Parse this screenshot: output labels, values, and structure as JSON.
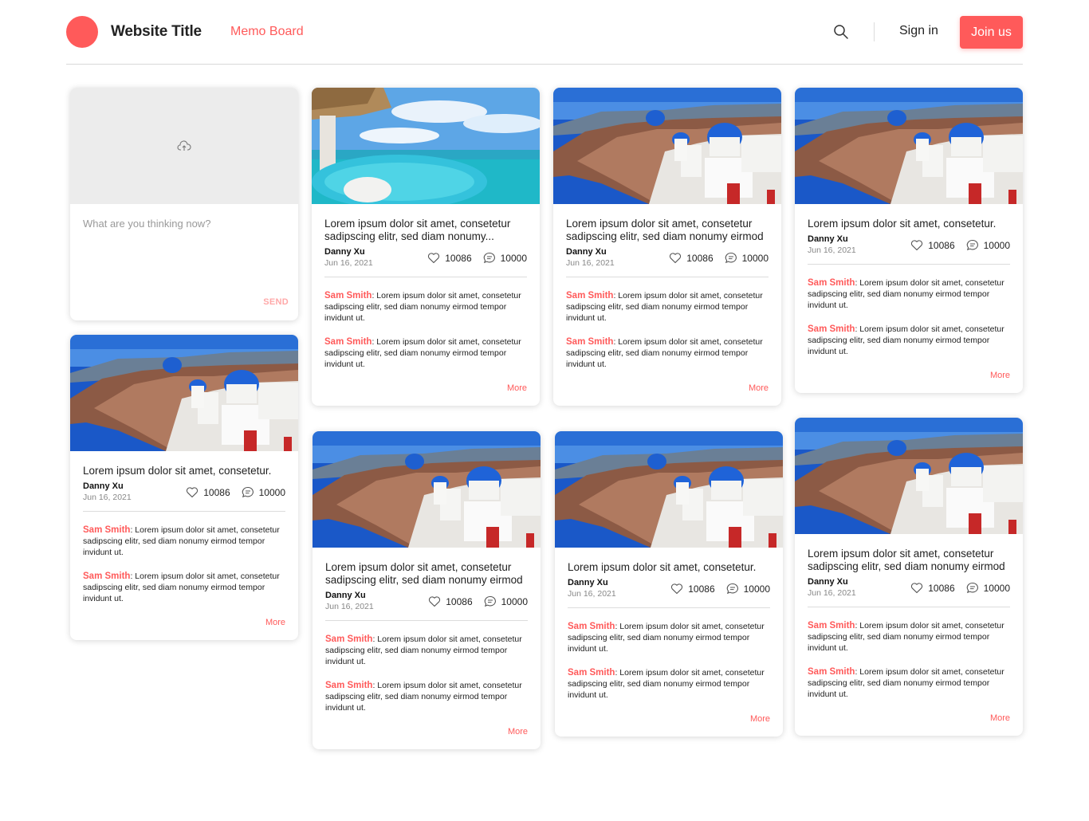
{
  "header": {
    "site_title": "Website Title",
    "nav_link": "Memo Board",
    "signin": "Sign in",
    "joinus": "Join us"
  },
  "compose": {
    "placeholder": "What are you thinking now?",
    "send_label": "SEND"
  },
  "comments": [
    {
      "name": "Sam Smith",
      "text": ": Lorem ipsum dolor sit amet, consetetur sadipscing elitr, sed diam nonumy eirmod tempor invidunt ut."
    },
    {
      "name": "Sam Smith",
      "text": ": Lorem ipsum dolor sit amet, consetetur sadipscing elitr, sed diam nonumy eirmod tempor invidunt ut."
    }
  ],
  "posts": [
    {
      "title": "Lorem ipsum dolor sit amet, consetetur.",
      "author": "Danny Xu",
      "date": "Jun 16, 2021",
      "likes": "10086",
      "comments_count": "10000",
      "more": "More",
      "image": "santorini"
    },
    {
      "title": "Lorem ipsum dolor sit amet, consetetur sadipscing elitr, sed diam nonumy...",
      "author": "Danny Xu",
      "date": "Jun 16, 2021",
      "likes": "10086",
      "comments_count": "10000",
      "more": "More",
      "image": "resort"
    },
    {
      "title": "Lorem ipsum dolor sit amet, consetetur sadipscing elitr, sed diam nonumy eirmod",
      "author": "Danny Xu",
      "date": "Jun 16, 2021",
      "likes": "10086",
      "comments_count": "10000",
      "more": "More",
      "image": "santorini"
    },
    {
      "title": "Lorem ipsum dolor sit amet, consetetur sadipscing elitr, sed diam nonumy eirmod",
      "author": "Danny Xu",
      "date": "Jun 16, 2021",
      "likes": "10086",
      "comments_count": "10000",
      "more": "More",
      "image": "santorini"
    },
    {
      "title": "Lorem ipsum dolor sit amet, consetetur.",
      "author": "Danny Xu",
      "date": "Jun 16, 2021",
      "likes": "10086",
      "comments_count": "10000",
      "more": "More",
      "image": "santorini"
    },
    {
      "title": "Lorem ipsum dolor sit amet, consetetur.",
      "author": "Danny Xu",
      "date": "Jun 16, 2021",
      "likes": "10086",
      "comments_count": "10000",
      "more": "More",
      "image": "santorini"
    },
    {
      "title": "Lorem ipsum dolor sit amet, consetetur sadipscing elitr, sed diam nonumy eirmod",
      "author": "Danny Xu",
      "date": "Jun 16, 2021",
      "likes": "10086",
      "comments_count": "10000",
      "more": "More",
      "image": "santorini"
    }
  ],
  "colors": {
    "accent": "#ff5a5a",
    "send_disabled": "#ffa8a8"
  }
}
